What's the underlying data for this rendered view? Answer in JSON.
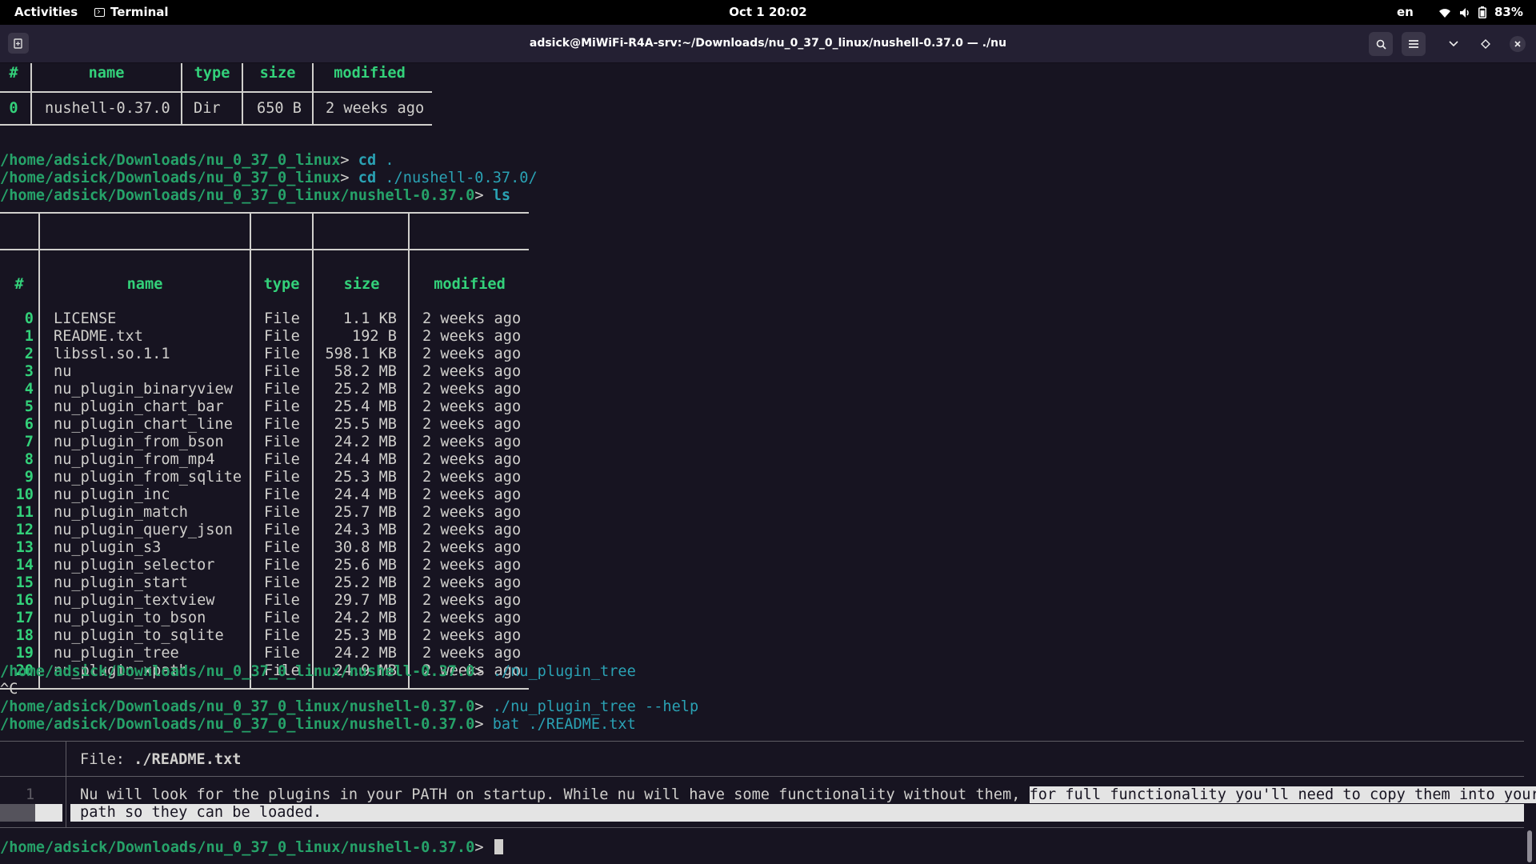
{
  "topbar": {
    "activities": "Activities",
    "app_name": "Terminal",
    "clock": "Oct 1  20:02",
    "lang": "en",
    "battery": "83%"
  },
  "window": {
    "title": "adsick@MiWiFi-R4A-srv:~/Downloads/nu_0_37_0_linux/nushell-0.37.0 — ./nu"
  },
  "table1": {
    "headers": [
      "#",
      "name",
      "type",
      "size",
      "modified"
    ],
    "rows": [
      {
        "idx": "0",
        "name": "nushell-0.37.0",
        "type": "Dir",
        "size": "650 B",
        "modified": "2 weeks ago"
      }
    ]
  },
  "prompts": [
    {
      "path": "/home/adsick/Downloads/nu_0_37_0_linux",
      "cmd": "cd",
      "arg": " ."
    },
    {
      "path": "/home/adsick/Downloads/nu_0_37_0_linux",
      "cmd": "cd",
      "arg": " ./nushell-0.37.0/"
    },
    {
      "path": "/home/adsick/Downloads/nu_0_37_0_linux/nushell-0.37.0",
      "cmd": "ls",
      "arg": ""
    }
  ],
  "table2": {
    "headers": [
      "#",
      "name",
      "type",
      "size",
      "modified"
    ],
    "rows": [
      {
        "idx": "0",
        "name": "LICENSE",
        "type": "File",
        "size": "1.1 KB",
        "modified": "2 weeks ago"
      },
      {
        "idx": "1",
        "name": "README.txt",
        "type": "File",
        "size": "192 B",
        "modified": "2 weeks ago"
      },
      {
        "idx": "2",
        "name": "libssl.so.1.1",
        "type": "File",
        "size": "598.1 KB",
        "modified": "2 weeks ago"
      },
      {
        "idx": "3",
        "name": "nu",
        "type": "File",
        "size": "58.2 MB",
        "modified": "2 weeks ago"
      },
      {
        "idx": "4",
        "name": "nu_plugin_binaryview",
        "type": "File",
        "size": "25.2 MB",
        "modified": "2 weeks ago"
      },
      {
        "idx": "5",
        "name": "nu_plugin_chart_bar",
        "type": "File",
        "size": "25.4 MB",
        "modified": "2 weeks ago"
      },
      {
        "idx": "6",
        "name": "nu_plugin_chart_line",
        "type": "File",
        "size": "25.5 MB",
        "modified": "2 weeks ago"
      },
      {
        "idx": "7",
        "name": "nu_plugin_from_bson",
        "type": "File",
        "size": "24.2 MB",
        "modified": "2 weeks ago"
      },
      {
        "idx": "8",
        "name": "nu_plugin_from_mp4",
        "type": "File",
        "size": "24.4 MB",
        "modified": "2 weeks ago"
      },
      {
        "idx": "9",
        "name": "nu_plugin_from_sqlite",
        "type": "File",
        "size": "25.3 MB",
        "modified": "2 weeks ago"
      },
      {
        "idx": "10",
        "name": "nu_plugin_inc",
        "type": "File",
        "size": "24.4 MB",
        "modified": "2 weeks ago"
      },
      {
        "idx": "11",
        "name": "nu_plugin_match",
        "type": "File",
        "size": "25.7 MB",
        "modified": "2 weeks ago"
      },
      {
        "idx": "12",
        "name": "nu_plugin_query_json",
        "type": "File",
        "size": "24.3 MB",
        "modified": "2 weeks ago"
      },
      {
        "idx": "13",
        "name": "nu_plugin_s3",
        "type": "File",
        "size": "30.8 MB",
        "modified": "2 weeks ago"
      },
      {
        "idx": "14",
        "name": "nu_plugin_selector",
        "type": "File",
        "size": "25.6 MB",
        "modified": "2 weeks ago"
      },
      {
        "idx": "15",
        "name": "nu_plugin_start",
        "type": "File",
        "size": "25.2 MB",
        "modified": "2 weeks ago"
      },
      {
        "idx": "16",
        "name": "nu_plugin_textview",
        "type": "File",
        "size": "29.7 MB",
        "modified": "2 weeks ago"
      },
      {
        "idx": "17",
        "name": "nu_plugin_to_bson",
        "type": "File",
        "size": "24.2 MB",
        "modified": "2 weeks ago"
      },
      {
        "idx": "18",
        "name": "nu_plugin_to_sqlite",
        "type": "File",
        "size": "25.3 MB",
        "modified": "2 weeks ago"
      },
      {
        "idx": "19",
        "name": "nu_plugin_tree",
        "type": "File",
        "size": "24.2 MB",
        "modified": "2 weeks ago"
      },
      {
        "idx": "20",
        "name": "nu_plugin_xpath",
        "type": "File",
        "size": "24.9 MB",
        "modified": "2 weeks ago"
      }
    ]
  },
  "history": [
    {
      "path": "/home/adsick/Downloads/nu_0_37_0_linux/nushell-0.37.0",
      "cmd": "./nu_plugin_tree"
    },
    {
      "text": "^C"
    },
    {
      "path": "/home/adsick/Downloads/nu_0_37_0_linux/nushell-0.37.0",
      "cmd": "./nu_plugin_tree --help"
    },
    {
      "path": "/home/adsick/Downloads/nu_0_37_0_linux/nushell-0.37.0",
      "cmd": "bat ./README.txt"
    }
  ],
  "bat": {
    "file_label": "File: ",
    "file_name": "./README.txt",
    "line_number": "1",
    "line_text_a": "Nu will look for the plugins in your PATH on startup. While nu will have some functionality without them, ",
    "line_text_b": "for full functionality you'll need to copy them into your",
    "line_text_c": "path so they can be loaded."
  },
  "final_prompt": {
    "path": "/home/adsick/Downloads/nu_0_37_0_linux/nushell-0.37.0",
    "arrow": "> "
  }
}
